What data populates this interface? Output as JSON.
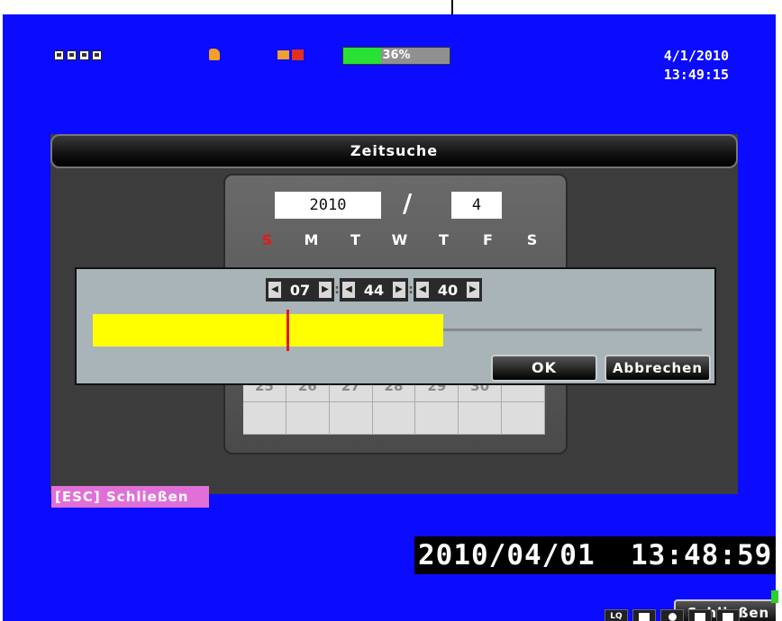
{
  "status_bar": {
    "hdd_percent": 36,
    "hdd_label": "36%",
    "date": "4/1/2010",
    "time": "13:49:15",
    "colors": {
      "background": "#0b0bff",
      "hdd_fill": "#29e035"
    }
  },
  "dialog": {
    "title": "Zeitsuche",
    "year": "2010",
    "separator": "/",
    "month": "4",
    "weekdays": [
      "S",
      "M",
      "T",
      "W",
      "T",
      "F",
      "S"
    ],
    "calendar_last_row": [
      "25",
      "26",
      "27",
      "28",
      "29",
      "30",
      ""
    ],
    "close_label": "Schließen"
  },
  "time_picker": {
    "hour": "07",
    "minute": "44",
    "second": "40",
    "ok_label": "OK",
    "cancel_label": "Abbrechen",
    "timeline_fill_fraction": 0.575
  },
  "footer": {
    "esc_hint": "[ESC] Schließen",
    "playback_datetime": "2010/04/01  13:48:59",
    "quality_label": "LQ"
  }
}
